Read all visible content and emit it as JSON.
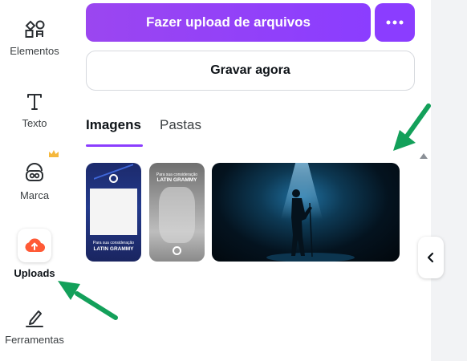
{
  "sidebar": {
    "items": [
      {
        "label": "Elementos",
        "icon": "elements-icon"
      },
      {
        "label": "Texto",
        "icon": "text-icon"
      },
      {
        "label": "Marca",
        "icon": "brand-icon"
      },
      {
        "label": "Uploads",
        "icon": "cloud-upload-icon"
      },
      {
        "label": "Ferramentas",
        "icon": "pen-tools-icon"
      }
    ],
    "premium_icon": "crown-icon"
  },
  "panel": {
    "upload_button_label": "Fazer upload de arquivos",
    "more_button_icon": "more-dots-icon",
    "record_button_label": "Gravar agora",
    "tabs": [
      {
        "label": "Imagens",
        "active": true
      },
      {
        "label": "Pastas",
        "active": false
      }
    ],
    "thumbnails": [
      {
        "caption_top": "Para sua consideração",
        "caption_title": "LATIN GRAMMY"
      },
      {
        "caption_top": "Para sua consideração",
        "caption_title": "LATIN GRAMMY"
      },
      {
        "description": "singer on stage under spotlight"
      }
    ]
  },
  "colors": {
    "accent": "#8b3dff",
    "annotation_arrow": "#13a05a",
    "uploads_icon": "#ff5a36"
  }
}
